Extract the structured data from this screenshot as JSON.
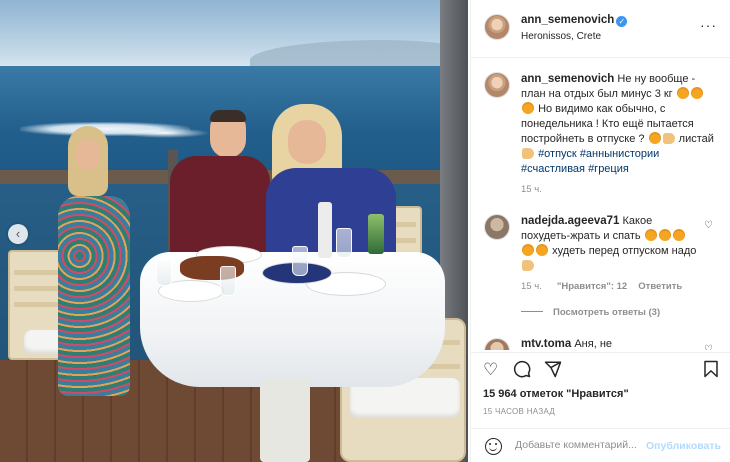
{
  "post": {
    "author": {
      "username": "ann_semenovich",
      "verified": true,
      "location": "Heronissos, Crete"
    },
    "caption": {
      "username": "ann_semenovich",
      "text_1": "Не ну вообще - план на отдых был минус 3 кг",
      "text_2": "Но видимо как обычно, с понедельника ! Кто ещё пытается постройнеть в отпуске ?",
      "text_3": "листай",
      "hashtags": [
        "#отпуск",
        "#аннынистории",
        "#счастливая",
        "#греция"
      ],
      "time": "15 ч."
    },
    "comments": [
      {
        "username": "nadejda.ageeva71",
        "text_1": "Какое похудеть-жрать и спать",
        "text_2": "худеть перед отпуском надо",
        "time": "15 ч.",
        "likes": "\"Нравится\": 12",
        "reply": "Ответить",
        "view_replies": "Посмотреть ответы (3)"
      },
      {
        "username": "mtv.toma",
        "text": "Аня, не"
      }
    ],
    "likes_count": "15 964 отметок \"Нравится\"",
    "time_ago": "15 ЧАСОВ НАЗАД",
    "comment_placeholder": "Добавьте комментарий...",
    "publish_label": "Опубликовать"
  },
  "icons": {
    "more": "more-horizontal-icon",
    "like": "heart-icon",
    "comment": "comment-icon",
    "share": "paper-plane-icon",
    "save": "bookmark-icon",
    "emoji": "smiley-icon",
    "carousel_prev": "chevron-left-icon"
  },
  "colors": {
    "link": "#00376b",
    "verified": "#3897f0",
    "muted": "#8e8e8e",
    "publish_disabled": "#b3dbff"
  }
}
